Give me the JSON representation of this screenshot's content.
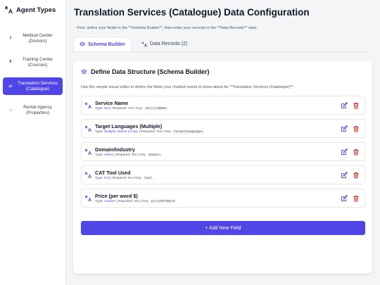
{
  "sidebar": {
    "title": "Agent Types",
    "items": [
      {
        "label_line1": "Medical Center",
        "label_line2": "(Doctors)",
        "icon": "pulse-icon",
        "glyph": "⫫"
      },
      {
        "label_line1": "Training Center",
        "label_line2": "(Courses)",
        "icon": "school-icon",
        "glyph": "⩩"
      },
      {
        "label_line1": "Translation Services",
        "label_line2": "(Catalogue)",
        "icon": "translate-icon",
        "glyph": "⇄",
        "active": true
      },
      {
        "label_line1": "Rental Agency",
        "label_line2": "(Properties)",
        "icon": "home-icon",
        "glyph": "⌂"
      }
    ]
  },
  "main": {
    "title": "Translation Services (Catalogue) Data Configuration",
    "intro": "· First, define your fields in the **Schema Builder**, then enter your records in the **Data Records** view.",
    "tabs": [
      {
        "label": "Schema Builder",
        "active": true
      },
      {
        "label": "Data Records (2)",
        "active": false
      }
    ]
  },
  "schema": {
    "title": "Define Data Structure (Schema Builder)",
    "description": "Use this simple visual editor to define the fields your chatbot needs to know about for **Translation Services (Catalogue)**.",
    "meta_labels": {
      "type": "Type:",
      "required": "| Required:",
      "key": "| Key:"
    },
    "fields": [
      {
        "name": "Service Name",
        "type": "text",
        "required": "Yes",
        "key": "serviceName"
      },
      {
        "name": "Target Languages (Multiple)",
        "type": "Multiple Values (Array)",
        "required": "Yes",
        "key": "targetLanguages"
      },
      {
        "name": "Domain/Industry",
        "type": "select",
        "required": "Yes",
        "key": "domain"
      },
      {
        "name": "CAT Tool Used",
        "type": "text",
        "required": "No",
        "key": "tool"
      },
      {
        "name": "Price (per word $)",
        "type": "number",
        "required": "Yes",
        "key": "pricePerWord"
      }
    ],
    "add_button": "+ Add New Field"
  },
  "colors": {
    "accent": "#4f46e5",
    "edit": "#4f46e5",
    "delete": "#dc2626"
  }
}
